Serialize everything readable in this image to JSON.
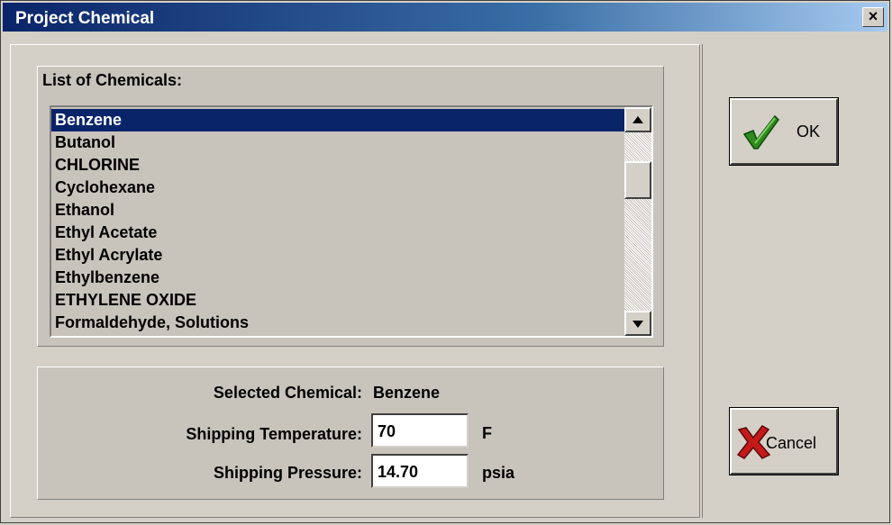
{
  "window": {
    "title": "Project Chemical",
    "close_label": "×"
  },
  "chemical_list": {
    "label": "List of Chemicals:",
    "items": [
      "Benzene",
      "Butanol",
      "CHLORINE",
      "Cyclohexane",
      "Ethanol",
      "Ethyl Acetate",
      "Ethyl Acrylate",
      "Ethylbenzene",
      "ETHYLENE OXIDE",
      "Formaldehyde, Solutions"
    ],
    "selected_index": 0
  },
  "details": {
    "selected_label": "Selected Chemical:",
    "selected_value": "Benzene",
    "temperature_label": "Shipping Temperature:",
    "temperature_value": "70",
    "temperature_unit": "F",
    "pressure_label": "Shipping Pressure:",
    "pressure_value": "14.70",
    "pressure_unit": "psia"
  },
  "buttons": {
    "ok_label": "OK",
    "cancel_label": "Cancel"
  },
  "icons": {
    "ok": "checkmark-icon",
    "cancel": "x-mark-icon"
  },
  "colors": {
    "titlebar": "#0a246a",
    "selection": "#0a246a",
    "ok_icon": "#2e8b1e",
    "cancel_icon": "#c41a1a"
  }
}
